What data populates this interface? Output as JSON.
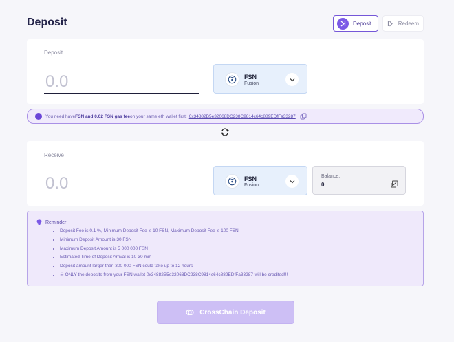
{
  "page": {
    "title": "Deposit"
  },
  "mode_toggle": {
    "deposit_label": "Deposit",
    "redeem_label": "Redeem"
  },
  "deposit_card": {
    "label": "Deposit",
    "amount_placeholder": "0.0",
    "token": {
      "symbol": "FSN",
      "chain": "Fusion",
      "icon": "fusion-logo-icon"
    }
  },
  "notice": {
    "text_before": "You need have ",
    "text_bold": "FSN and 0.02 FSN gas fee",
    "text_after": " on your same eth wallet first:",
    "address": "0x34882B5e32068DC238C9814c64c889EDfFa33287",
    "icon": "copy-icon"
  },
  "receive_card": {
    "label": "Receive",
    "amount_placeholder": "0.0",
    "token": {
      "symbol": "FSN",
      "chain": "Fusion",
      "icon": "fusion-logo-icon"
    },
    "balance": {
      "label": "Balance:",
      "value": "0"
    }
  },
  "reminder": {
    "title": "Reminder:",
    "items": [
      "Deposit Fee is 0.1 %, Minimum Deposit Fee is 10 FSN, Maximum Deposit Fee is 100 FSN",
      "Minimum Deposit Amount is 30 FSN",
      "Maximum Deposit Amount is 5 000 000 FSN",
      "Estimated Time of Deposit Arrival is 10-30 min",
      "Deposit amount larger than 300 000 FSN could take up to 12 hours",
      "ONLY the deposits from your FSN wallet 0x34882B5e32068DC238C9814c64c889EDfFa33287 will be credited!!!"
    ]
  },
  "submit": {
    "label": "CrossChain Deposit"
  },
  "colors": {
    "accent": "#7b59e6",
    "token_bg": "#e7f0fc",
    "notice_bg": "#f0eafc",
    "submit_bg": "#cdbff5"
  }
}
